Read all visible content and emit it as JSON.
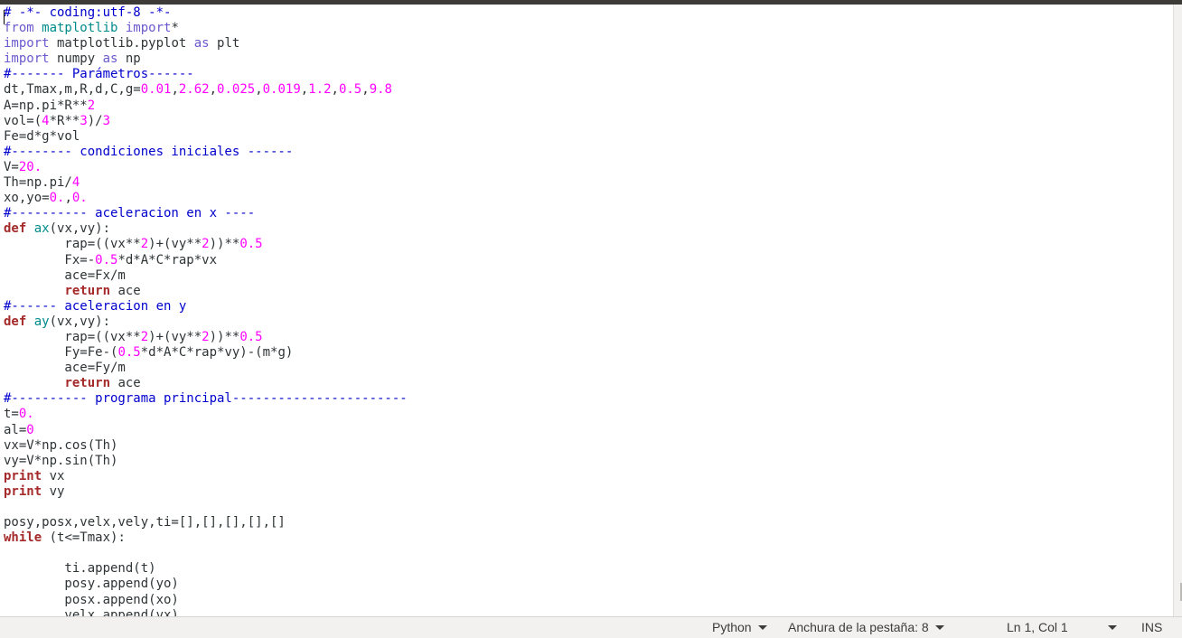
{
  "editor": {
    "lines": [
      [
        {
          "t": "# -*- coding:utf-8 -*-",
          "c": "c"
        }
      ],
      [
        {
          "t": "from",
          "c": "i"
        },
        {
          "t": " matplotlib ",
          "c": "f"
        },
        {
          "t": "import",
          "c": "i"
        },
        {
          "t": "*",
          "c": "p"
        }
      ],
      [
        {
          "t": "import",
          "c": "i"
        },
        {
          "t": " matplotlib.pyplot ",
          "c": "p"
        },
        {
          "t": "as",
          "c": "i"
        },
        {
          "t": " plt",
          "c": "p"
        }
      ],
      [
        {
          "t": "import",
          "c": "i"
        },
        {
          "t": " numpy ",
          "c": "p"
        },
        {
          "t": "as",
          "c": "i"
        },
        {
          "t": " np",
          "c": "p"
        }
      ],
      [
        {
          "t": "#------- Parámetros------",
          "c": "c"
        }
      ],
      [
        {
          "t": "dt,Tmax,m,R,d,C,g=",
          "c": "p"
        },
        {
          "t": "0.01",
          "c": "n"
        },
        {
          "t": ",",
          "c": "p"
        },
        {
          "t": "2.62",
          "c": "n"
        },
        {
          "t": ",",
          "c": "p"
        },
        {
          "t": "0.025",
          "c": "n"
        },
        {
          "t": ",",
          "c": "p"
        },
        {
          "t": "0.019",
          "c": "n"
        },
        {
          "t": ",",
          "c": "p"
        },
        {
          "t": "1.2",
          "c": "n"
        },
        {
          "t": ",",
          "c": "p"
        },
        {
          "t": "0.5",
          "c": "n"
        },
        {
          "t": ",",
          "c": "p"
        },
        {
          "t": "9.8",
          "c": "n"
        }
      ],
      [
        {
          "t": "A=np.pi*R**",
          "c": "p"
        },
        {
          "t": "2",
          "c": "n"
        }
      ],
      [
        {
          "t": "vol=(",
          "c": "p"
        },
        {
          "t": "4",
          "c": "n"
        },
        {
          "t": "*R**",
          "c": "p"
        },
        {
          "t": "3",
          "c": "n"
        },
        {
          "t": ")/",
          "c": "p"
        },
        {
          "t": "3",
          "c": "n"
        }
      ],
      [
        {
          "t": "Fe=d*g*vol",
          "c": "p"
        }
      ],
      [
        {
          "t": "#-------- condiciones iniciales ------",
          "c": "c"
        }
      ],
      [
        {
          "t": "V=",
          "c": "p"
        },
        {
          "t": "20.",
          "c": "n"
        }
      ],
      [
        {
          "t": "Th=np.pi/",
          "c": "p"
        },
        {
          "t": "4",
          "c": "n"
        }
      ],
      [
        {
          "t": "xo,yo=",
          "c": "p"
        },
        {
          "t": "0.",
          "c": "n"
        },
        {
          "t": ",",
          "c": "p"
        },
        {
          "t": "0.",
          "c": "n"
        }
      ],
      [
        {
          "t": "#---------- aceleracion en x ----",
          "c": "c"
        }
      ],
      [
        {
          "t": "def",
          "c": "k"
        },
        {
          "t": " ",
          "c": "p"
        },
        {
          "t": "ax",
          "c": "f"
        },
        {
          "t": "(vx,vy):",
          "c": "p"
        }
      ],
      [
        {
          "t": "        rap=((vx**",
          "c": "p"
        },
        {
          "t": "2",
          "c": "n"
        },
        {
          "t": ")+(vy**",
          "c": "p"
        },
        {
          "t": "2",
          "c": "n"
        },
        {
          "t": "))**",
          "c": "p"
        },
        {
          "t": "0.5",
          "c": "n"
        }
      ],
      [
        {
          "t": "        Fx=-",
          "c": "p"
        },
        {
          "t": "0.5",
          "c": "n"
        },
        {
          "t": "*d*A*C*rap*vx",
          "c": "p"
        }
      ],
      [
        {
          "t": "        ace=Fx/m",
          "c": "p"
        }
      ],
      [
        {
          "t": "        ",
          "c": "p"
        },
        {
          "t": "return",
          "c": "k"
        },
        {
          "t": " ace",
          "c": "p"
        }
      ],
      [
        {
          "t": "#------ aceleracion en y",
          "c": "c"
        }
      ],
      [
        {
          "t": "def",
          "c": "k"
        },
        {
          "t": " ",
          "c": "p"
        },
        {
          "t": "ay",
          "c": "f"
        },
        {
          "t": "(vx,vy):",
          "c": "p"
        }
      ],
      [
        {
          "t": "        rap=((vx**",
          "c": "p"
        },
        {
          "t": "2",
          "c": "n"
        },
        {
          "t": ")+(vy**",
          "c": "p"
        },
        {
          "t": "2",
          "c": "n"
        },
        {
          "t": "))**",
          "c": "p"
        },
        {
          "t": "0.5",
          "c": "n"
        }
      ],
      [
        {
          "t": "        Fy=Fe-(",
          "c": "p"
        },
        {
          "t": "0.5",
          "c": "n"
        },
        {
          "t": "*d*A*C*rap*vy)-(m*g)",
          "c": "p"
        }
      ],
      [
        {
          "t": "        ace=Fy/m",
          "c": "p"
        }
      ],
      [
        {
          "t": "        ",
          "c": "p"
        },
        {
          "t": "return",
          "c": "k"
        },
        {
          "t": " ace",
          "c": "p"
        }
      ],
      [
        {
          "t": "#---------- programa principal-----------------------",
          "c": "c"
        }
      ],
      [
        {
          "t": "t=",
          "c": "p"
        },
        {
          "t": "0.",
          "c": "n"
        }
      ],
      [
        {
          "t": "al=",
          "c": "p"
        },
        {
          "t": "0",
          "c": "n"
        }
      ],
      [
        {
          "t": "vx=V*np.cos(Th)",
          "c": "p"
        }
      ],
      [
        {
          "t": "vy=V*np.sin(Th)",
          "c": "p"
        }
      ],
      [
        {
          "t": "print",
          "c": "k"
        },
        {
          "t": " vx",
          "c": "p"
        }
      ],
      [
        {
          "t": "print",
          "c": "k"
        },
        {
          "t": " vy",
          "c": "p"
        }
      ],
      [
        {
          "t": "",
          "c": "p"
        }
      ],
      [
        {
          "t": "posy,posx,velx,vely,ti=[],[],[],[],[]",
          "c": "p"
        }
      ],
      [
        {
          "t": "while",
          "c": "k"
        },
        {
          "t": " (t<=Tmax):",
          "c": "p"
        }
      ],
      [
        {
          "t": "",
          "c": "p"
        }
      ],
      [
        {
          "t": "        ti.append(t)",
          "c": "p"
        }
      ],
      [
        {
          "t": "        posy.append(yo)",
          "c": "p"
        }
      ],
      [
        {
          "t": "        posx.append(xo)",
          "c": "p"
        }
      ],
      [
        {
          "t": "        velx.append(vx)",
          "c": "p"
        }
      ]
    ]
  },
  "statusbar": {
    "language": "Python",
    "tab_width": "Anchura de la pestaña: 8",
    "position": "Ln 1, Col 1",
    "mode": "INS"
  }
}
